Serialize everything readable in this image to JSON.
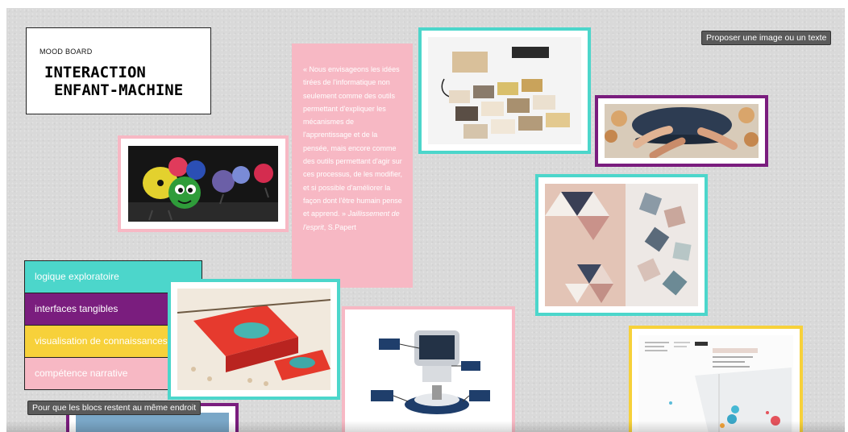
{
  "header": {
    "subtitle": "MOOD BOARD",
    "title_line1": "INTERACTION",
    "title_line2": "ENFANT-MACHINE"
  },
  "toolbar": {
    "propose_label": "Proposer une image ou un texte",
    "fixed_blocks_label": "Pour que les blocs restent au même endroit"
  },
  "quote": {
    "text": "« Nous envisageons les idées tirées de l'informatique non seulement comme des outils permettant d'expliquer les mécanismes de l'apprentissage et de la pensée, mais encore comme des outils permettant d'agir sur ces processus, de les modifier, et si possible d'améliorer la façon dont l'être humain pense et apprend. »",
    "source": "Jaillissement de l'esprit",
    "author": ", S.Papert"
  },
  "legend": {
    "items": [
      {
        "label": "logique exploratoire",
        "color": "#4cd6cb"
      },
      {
        "label": "interfaces tangibles",
        "color": "#7a1d7e"
      },
      {
        "label": "visualisation de connaissances",
        "color": "#f7d13a"
      },
      {
        "label": "compétence narrative",
        "color": "#f7b8c4"
      }
    ]
  },
  "colors": {
    "teal": "#4cd6cb",
    "purple": "#7a1d7e",
    "yellow": "#f7d13a",
    "pink": "#f7b8c4",
    "board": "#d9d9d9"
  }
}
